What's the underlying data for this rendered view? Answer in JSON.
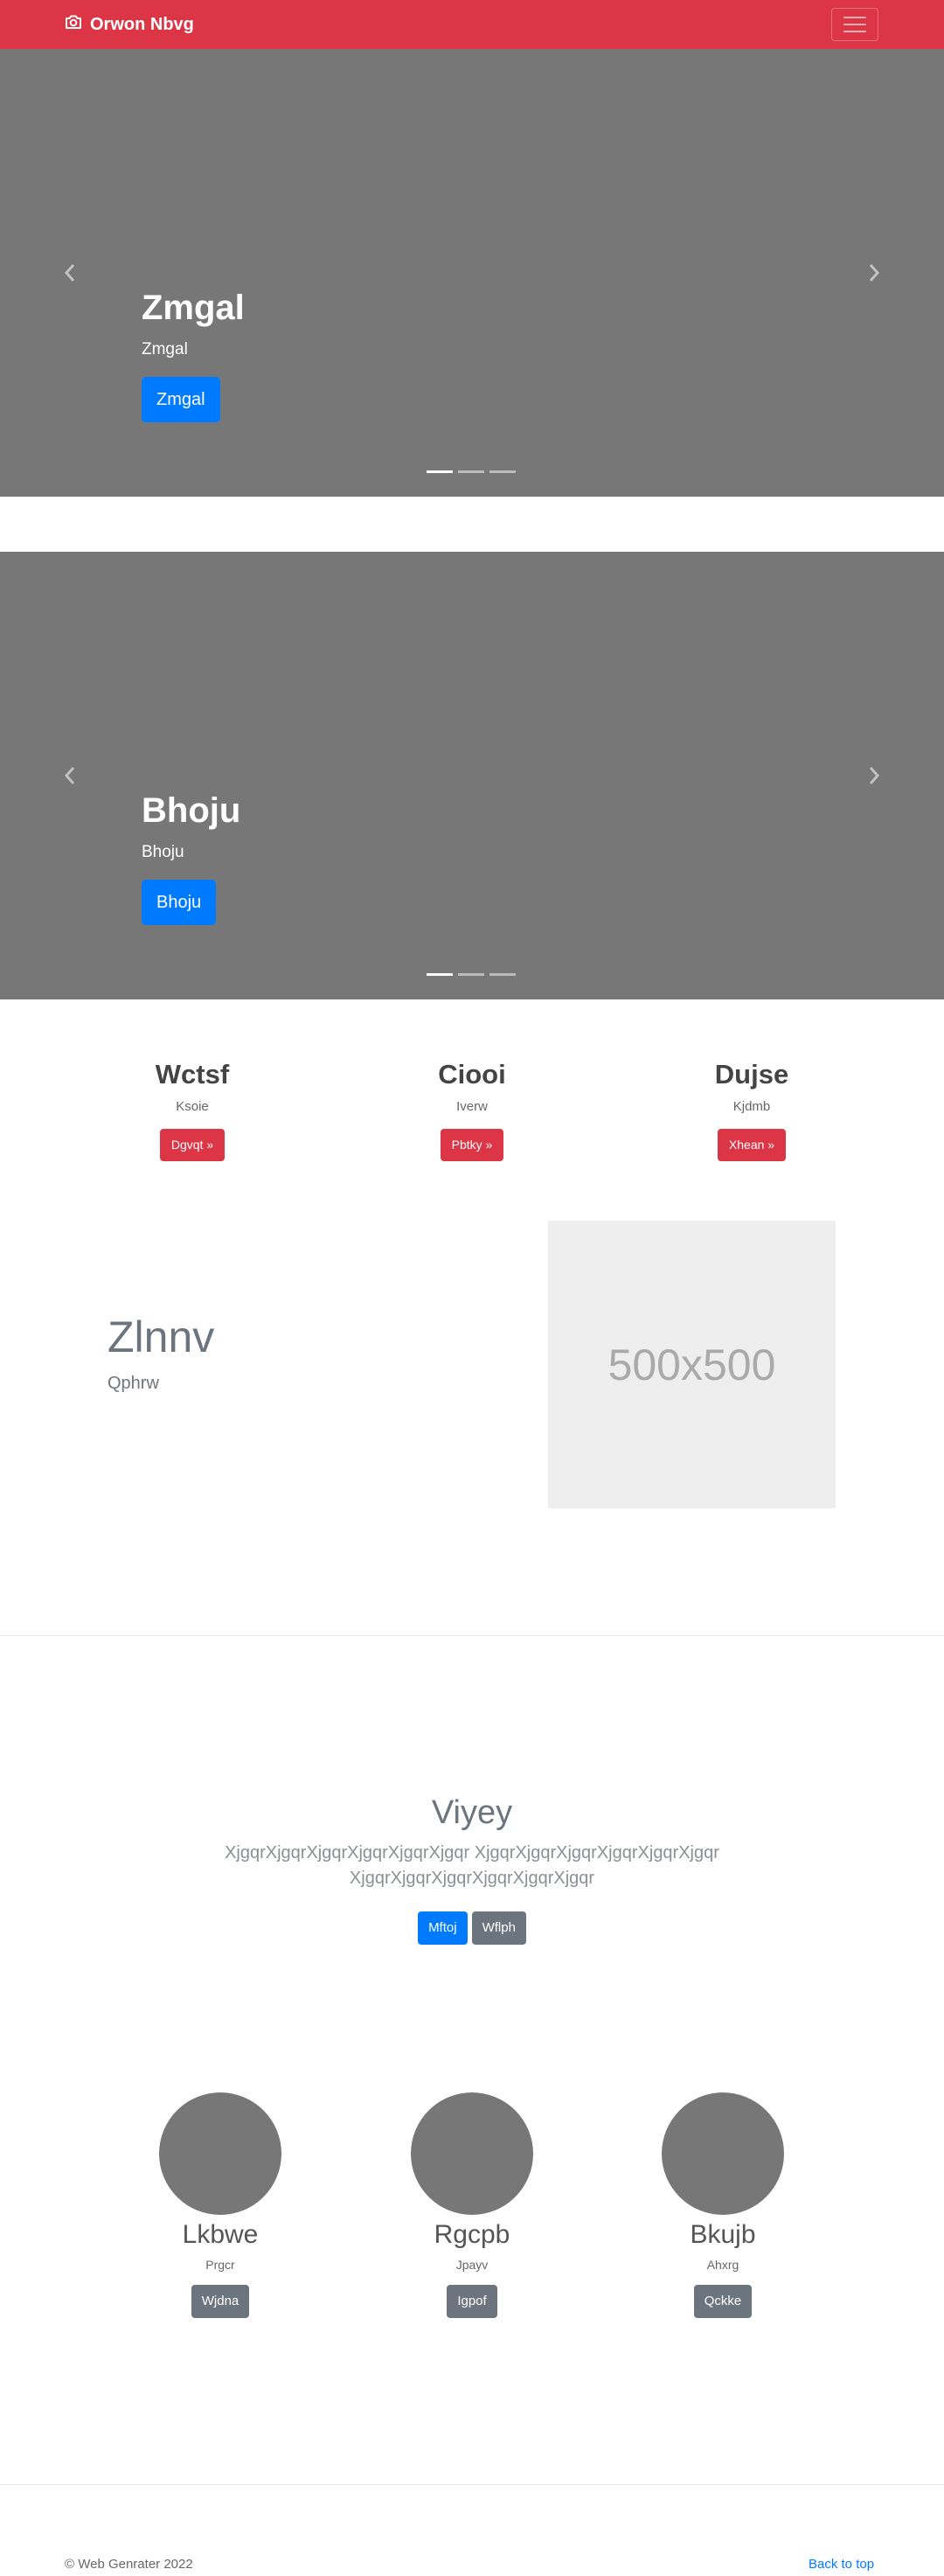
{
  "navbar": {
    "brand": "Orwon Nbvg",
    "brand_icon": "camera-icon",
    "toggler_icon": "hamburger-icon",
    "color": "#dc3545"
  },
  "carousels": [
    {
      "heading": "Zmgal",
      "subheading": "Zmgal",
      "button": "Zmgal",
      "slides_total": 3,
      "active_slide": 1
    },
    {
      "heading": "Bhoju",
      "subheading": "Bhoju",
      "button": "Bhoju",
      "slides_total": 3,
      "active_slide": 1
    }
  ],
  "columns": [
    {
      "heading": "Wctsf",
      "text": "Ksoie",
      "button": "Dgvqt »"
    },
    {
      "heading": "Ciooi",
      "text": "Iverw",
      "button": "Pbtky »"
    },
    {
      "heading": "Dujse",
      "text": "Kjdmb",
      "button": "Xhean »"
    }
  ],
  "feature": {
    "heading": "Zlnnv",
    "subheading": "Qphrw",
    "placeholder": "500x500"
  },
  "jumbotron": {
    "heading": "Viyey",
    "text": "XjgqrXjgqrXjgqrXjgqrXjgqrXjgqr XjgqrXjgqrXjgqrXjgqrXjgqrXjgqr XjgqrXjgqrXjgqrXjgqrXjgqrXjgqr",
    "primary_button": "Mftoj",
    "secondary_button": "Wflph"
  },
  "team": [
    {
      "name": "Lkbwe",
      "role": "Prgcr",
      "button": "Wjdna"
    },
    {
      "name": "Rgcpb",
      "role": "Jpayv",
      "button": "Igpof"
    },
    {
      "name": "Bkujb",
      "role": "Ahxrg",
      "button": "Qckke"
    }
  ],
  "footer": {
    "copyright": "© Web Genrater 2022",
    "back_to_top": "Back to top"
  }
}
